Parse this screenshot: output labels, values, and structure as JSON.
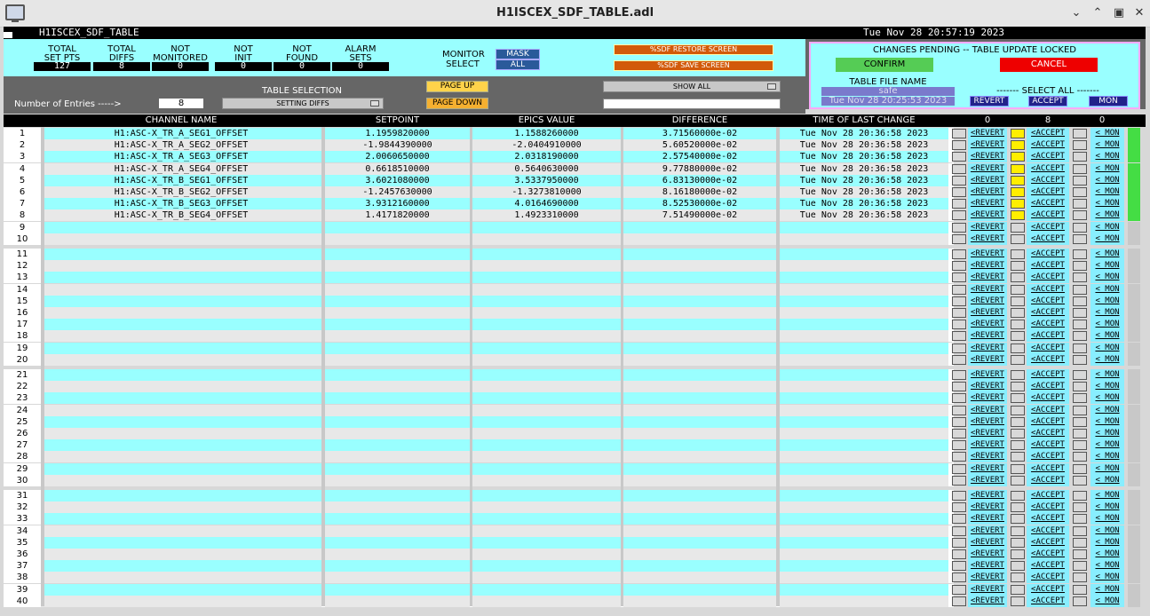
{
  "window": {
    "title": "H1ISCEX_SDF_TABLE.adl"
  },
  "header": {
    "screen_name": "H1ISCEX_SDF_TABLE",
    "datetime": "Tue Nov 28 20:57:19 2023"
  },
  "stats": [
    {
      "label1": "TOTAL",
      "label2": "SET PTS",
      "value": "127"
    },
    {
      "label1": "TOTAL",
      "label2": "DIFFS",
      "value": "8"
    },
    {
      "label1": "NOT",
      "label2": "MONITORED",
      "value": "0"
    },
    {
      "label1": "NOT",
      "label2": "INIT",
      "value": "0"
    },
    {
      "label1": "NOT",
      "label2": "FOUND",
      "value": "0"
    },
    {
      "label1": "ALARM",
      "label2": "SETS",
      "value": "0"
    }
  ],
  "monitor_select": {
    "label1": "MONITOR",
    "label2": "SELECT",
    "mask": "MASK",
    "all": "ALL"
  },
  "restore_btn": "%SDF RESTORE SCREEN",
  "save_btn": "%SDF SAVE SCREEN",
  "pending": {
    "title": "CHANGES PENDING -- TABLE UPDATE LOCKED",
    "confirm": "CONFIRM",
    "cancel": "CANCEL",
    "file_label": "TABLE FILE NAME",
    "file_name": "safe",
    "file_time": "Tue Nov 28 20:25:53 2023",
    "select_all": "------- SELECT ALL -------",
    "revert": "REVERT",
    "accept": "ACCEPT",
    "mon": "MON"
  },
  "entries": {
    "label": "Number of Entries ----->",
    "value": "8"
  },
  "table_selection": {
    "label": "TABLE SELECTION",
    "value": "SETTING DIFFS"
  },
  "page_up": "PAGE UP",
  "page_down": "PAGE DOWN",
  "show_all": "SHOW ALL",
  "columns": {
    "channel": "CHANNEL NAME",
    "setpoint": "SETPOINT",
    "epics": "EPICS VALUE",
    "difference": "DIFFERENCE",
    "time": "TIME OF LAST CHANGE",
    "count_revert": "0",
    "count_accept": "8",
    "count_mon": "0"
  },
  "row_buttons": {
    "revert": "<REVERT",
    "accept": "<ACCEPT",
    "mon": "< MON"
  },
  "rows": [
    {
      "num": "1",
      "channel": "H1:ASC-X_TR_A_SEG1_OFFSET",
      "setpoint": "1.1959820000",
      "epics": "1.1588260000",
      "difference": "3.71560000e-02",
      "time": "Tue Nov 28 20:36:58 2023"
    },
    {
      "num": "2",
      "channel": "H1:ASC-X_TR_A_SEG2_OFFSET",
      "setpoint": "-1.9844390000",
      "epics": "-2.0404910000",
      "difference": "5.60520000e-02",
      "time": "Tue Nov 28 20:36:58 2023"
    },
    {
      "num": "3",
      "channel": "H1:ASC-X_TR_A_SEG3_OFFSET",
      "setpoint": "2.0060650000",
      "epics": "2.0318190000",
      "difference": "2.57540000e-02",
      "time": "Tue Nov 28 20:36:58 2023"
    },
    {
      "num": "4",
      "channel": "H1:ASC-X_TR_A_SEG4_OFFSET",
      "setpoint": "0.6618510000",
      "epics": "0.5640630000",
      "difference": "9.77880000e-02",
      "time": "Tue Nov 28 20:36:58 2023"
    },
    {
      "num": "5",
      "channel": "H1:ASC-X_TR_B_SEG1_OFFSET",
      "setpoint": "3.6021080000",
      "epics": "3.5337950000",
      "difference": "6.83130000e-02",
      "time": "Tue Nov 28 20:36:58 2023"
    },
    {
      "num": "6",
      "channel": "H1:ASC-X_TR_B_SEG2_OFFSET",
      "setpoint": "-1.2457630000",
      "epics": "-1.3273810000",
      "difference": "8.16180000e-02",
      "time": "Tue Nov 28 20:36:58 2023"
    },
    {
      "num": "7",
      "channel": "H1:ASC-X_TR_B_SEG3_OFFSET",
      "setpoint": "3.9312160000",
      "epics": "4.0164690000",
      "difference": "8.52530000e-02",
      "time": "Tue Nov 28 20:36:58 2023"
    },
    {
      "num": "8",
      "channel": "H1:ASC-X_TR_B_SEG4_OFFSET",
      "setpoint": "1.4171820000",
      "epics": "1.4923310000",
      "difference": "7.51490000e-02",
      "time": "Tue Nov 28 20:36:58 2023"
    },
    {
      "num": "9"
    },
    {
      "num": "10"
    },
    {
      "num": "11"
    },
    {
      "num": "12"
    },
    {
      "num": "13"
    },
    {
      "num": "14"
    },
    {
      "num": "15"
    },
    {
      "num": "16"
    },
    {
      "num": "17"
    },
    {
      "num": "18"
    },
    {
      "num": "19"
    },
    {
      "num": "20"
    },
    {
      "num": "21"
    },
    {
      "num": "22"
    },
    {
      "num": "23"
    },
    {
      "num": "24"
    },
    {
      "num": "25"
    },
    {
      "num": "26"
    },
    {
      "num": "27"
    },
    {
      "num": "28"
    },
    {
      "num": "29"
    },
    {
      "num": "30"
    },
    {
      "num": "31"
    },
    {
      "num": "32"
    },
    {
      "num": "33"
    },
    {
      "num": "34"
    },
    {
      "num": "35"
    },
    {
      "num": "36"
    },
    {
      "num": "37"
    },
    {
      "num": "38"
    },
    {
      "num": "39"
    },
    {
      "num": "40"
    }
  ],
  "colors": {
    "cyan": "#99ffff",
    "row_gray": "#e8e8e8",
    "accept_active": "#ffee00",
    "mon_active": "#44dd44"
  }
}
